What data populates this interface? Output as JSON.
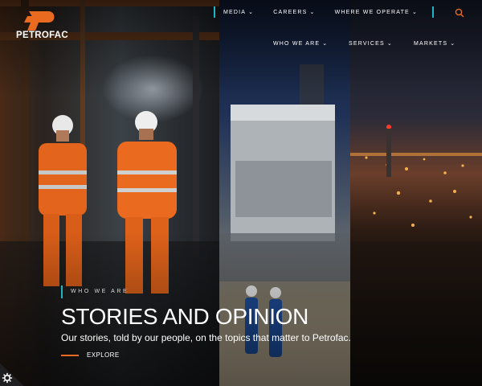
{
  "brand": {
    "name": "PETROFAC",
    "accent": "#ea6a1f",
    "divider": "#1db5c1"
  },
  "top_nav": [
    {
      "label": "MEDIA",
      "icon": "chevron-down-icon"
    },
    {
      "label": "CAREERS",
      "icon": "chevron-down-icon"
    },
    {
      "label": "WHERE WE OPERATE",
      "icon": "chevron-down-icon"
    }
  ],
  "search": {
    "icon": "search-icon"
  },
  "main_nav": [
    {
      "label": "WHO WE ARE",
      "icon": "chevron-down-icon"
    },
    {
      "label": "SERVICES",
      "icon": "chevron-down-icon"
    },
    {
      "label": "MARKETS",
      "icon": "chevron-down-icon"
    }
  ],
  "hero": {
    "eyebrow": "WHO WE ARE",
    "title": "STORIES AND OPINION",
    "subtitle": "Our stories, told by our people, on the topics that matter to Petrofac.",
    "cta": "EXPLORE"
  },
  "cookie": {
    "icon": "gear-icon"
  }
}
